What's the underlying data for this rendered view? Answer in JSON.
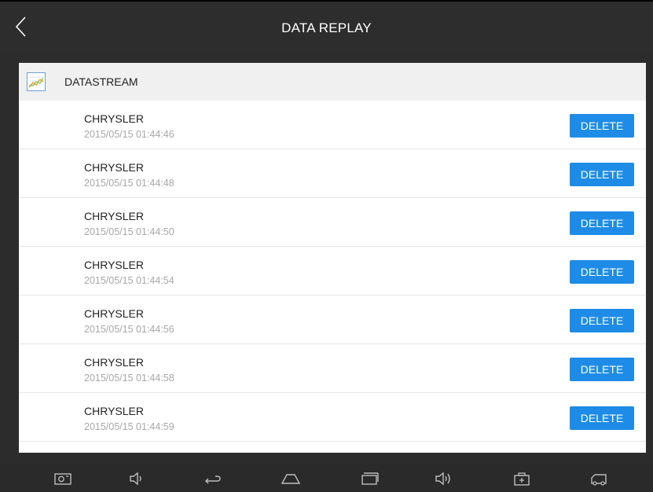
{
  "header": {
    "title": "DATA REPLAY"
  },
  "section": {
    "title": "DATASTREAM"
  },
  "records": [
    {
      "name": "CHRYSLER",
      "date": "2015/05/15 01:44:46",
      "action": "DELETE"
    },
    {
      "name": "CHRYSLER",
      "date": "2015/05/15 01:44:48",
      "action": "DELETE"
    },
    {
      "name": "CHRYSLER",
      "date": "2015/05/15 01:44:50",
      "action": "DELETE"
    },
    {
      "name": "CHRYSLER",
      "date": "2015/05/15 01:44:54",
      "action": "DELETE"
    },
    {
      "name": "CHRYSLER",
      "date": "2015/05/15 01:44:56",
      "action": "DELETE"
    },
    {
      "name": "CHRYSLER",
      "date": "2015/05/15 01:44:58",
      "action": "DELETE"
    },
    {
      "name": "CHRYSLER",
      "date": "2015/05/15 01:44:59",
      "action": "DELETE"
    }
  ],
  "navbar": {
    "icons": [
      "screenshot-icon",
      "volume-down-icon",
      "back-icon",
      "home-icon",
      "recent-apps-icon",
      "volume-up-icon",
      "toolbox-icon",
      "vci-icon"
    ]
  },
  "colors": {
    "accent": "#1e8ce6",
    "topbar": "#2d2d2d",
    "section_bg": "#f0f0f0"
  }
}
